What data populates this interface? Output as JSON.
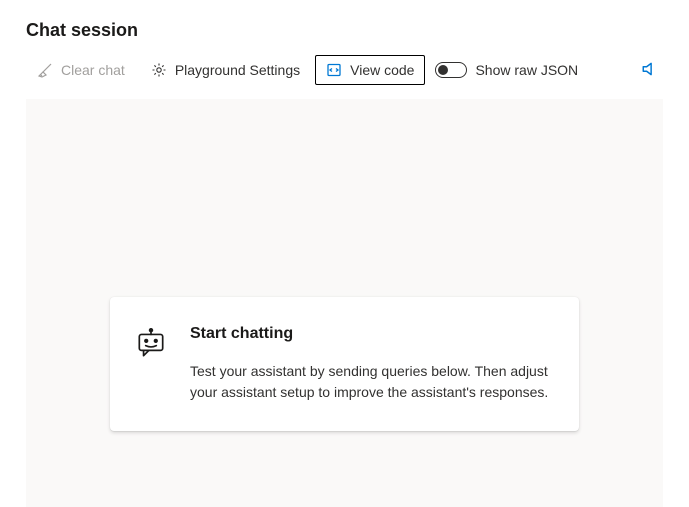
{
  "header": {
    "title": "Chat session"
  },
  "toolbar": {
    "clear_label": "Clear chat",
    "settings_label": "Playground Settings",
    "view_code_label": "View code",
    "raw_json_label": "Show raw JSON"
  },
  "empty_state": {
    "title": "Start chatting",
    "body": "Test your assistant by sending queries below. Then adjust your assistant setup to improve the assistant's responses."
  },
  "colors": {
    "accent": "#0078d4",
    "surface": "#faf9f8"
  }
}
